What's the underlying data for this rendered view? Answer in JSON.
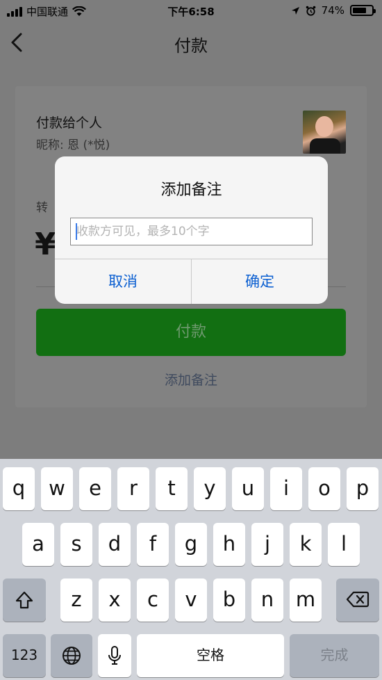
{
  "status_bar": {
    "carrier": "中国联通",
    "time": "下午6:58",
    "battery_percent": "74%",
    "battery_level": 0.74,
    "icons": [
      "signal-icon",
      "wifi-icon",
      "location-icon",
      "alarm-icon",
      "battery-icon"
    ]
  },
  "nav": {
    "title": "付款",
    "back_icon": "back-chevron-icon"
  },
  "payee": {
    "heading": "付款给个人",
    "nickname": "昵称: 恩 (*悦)"
  },
  "amount": {
    "label_visible": "转",
    "currency": "¥"
  },
  "pay_button": {
    "label": "付款",
    "color": "#126f12"
  },
  "add_note_link": "添加备注",
  "dialog": {
    "title": "添加备注",
    "input_placeholder": "收款方可见，最多10个字",
    "input_value": "",
    "cancel": "取消",
    "confirm": "确定",
    "button_color": "#0b5fd1"
  },
  "keyboard": {
    "row1": [
      "q",
      "w",
      "e",
      "r",
      "t",
      "y",
      "u",
      "i",
      "o",
      "p"
    ],
    "row2": [
      "a",
      "s",
      "d",
      "f",
      "g",
      "h",
      "j",
      "k",
      "l"
    ],
    "row3": [
      "z",
      "x",
      "c",
      "v",
      "b",
      "n",
      "m"
    ],
    "shift_icon": "shift-icon",
    "delete_icon": "delete-icon",
    "numbers_key": "123",
    "globe_icon": "globe-icon",
    "mic_icon": "microphone-icon",
    "space": "空格",
    "done": "完成"
  }
}
